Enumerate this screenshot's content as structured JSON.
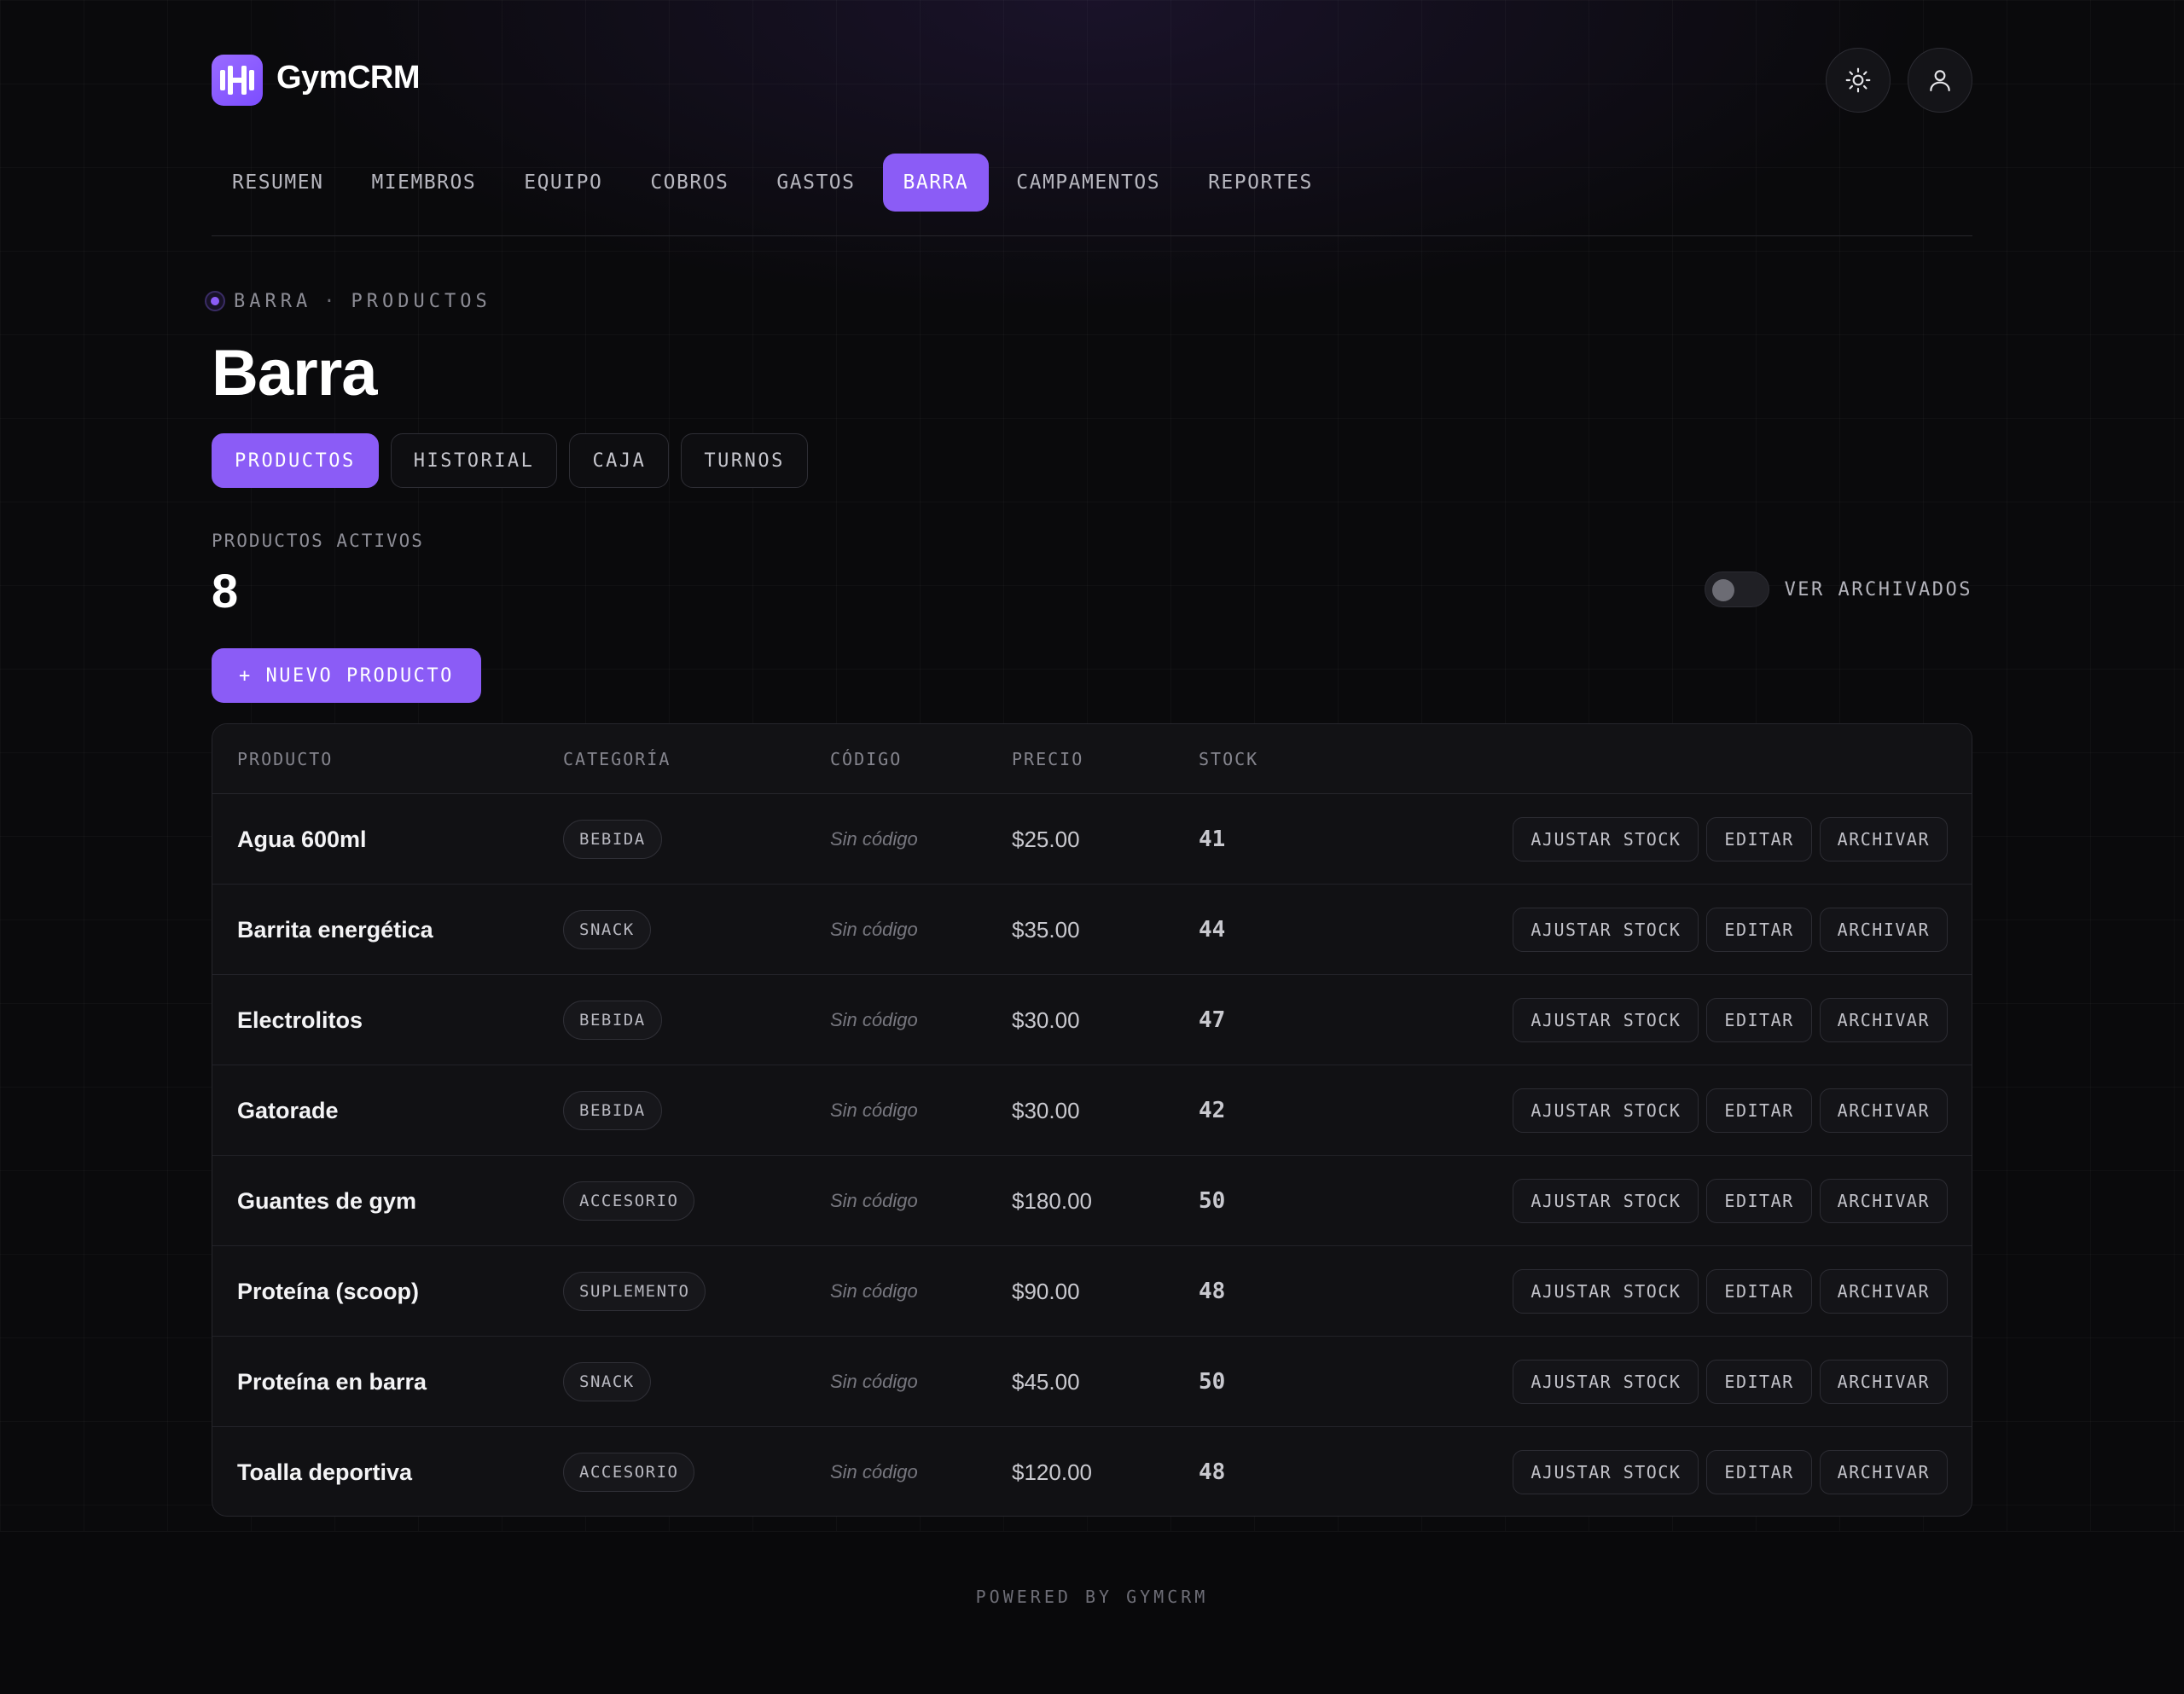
{
  "brand": {
    "name": "GymCRM"
  },
  "nav": {
    "items": [
      {
        "label": "RESUMEN",
        "active": false
      },
      {
        "label": "MIEMBROS",
        "active": false
      },
      {
        "label": "EQUIPO",
        "active": false
      },
      {
        "label": "COBROS",
        "active": false
      },
      {
        "label": "GASTOS",
        "active": false
      },
      {
        "label": "BARRA",
        "active": true
      },
      {
        "label": "CAMPAMENTOS",
        "active": false
      },
      {
        "label": "REPORTES",
        "active": false
      }
    ]
  },
  "header_icons": {
    "theme": "sun-icon",
    "profile": "user-icon"
  },
  "breadcrumb": {
    "section": "BARRA",
    "separator": "·",
    "page": "PRODUCTOS"
  },
  "page": {
    "title": "Barra"
  },
  "subtabs": [
    {
      "label": "PRODUCTOS",
      "active": true
    },
    {
      "label": "HISTORIAL",
      "active": false
    },
    {
      "label": "CAJA",
      "active": false
    },
    {
      "label": "TURNOS",
      "active": false
    }
  ],
  "stats": {
    "label": "PRODUCTOS ACTIVOS",
    "value": "8"
  },
  "archived_toggle": {
    "label": "VER ARCHIVADOS",
    "on": false
  },
  "new_product_button": {
    "label": "+ NUEVO PRODUCTO"
  },
  "table": {
    "columns": [
      "PRODUCTO",
      "CATEGORÍA",
      "CÓDIGO",
      "PRECIO",
      "STOCK"
    ],
    "actions": {
      "adjust": "AJUSTAR STOCK",
      "edit": "EDITAR",
      "archive": "ARCHIVAR"
    },
    "rows": [
      {
        "name": "Agua 600ml",
        "category": "BEBIDA",
        "code": "Sin código",
        "price": "$25.00",
        "stock": "41"
      },
      {
        "name": "Barrita energética",
        "category": "SNACK",
        "code": "Sin código",
        "price": "$35.00",
        "stock": "44"
      },
      {
        "name": "Electrolitos",
        "category": "BEBIDA",
        "code": "Sin código",
        "price": "$30.00",
        "stock": "47"
      },
      {
        "name": "Gatorade",
        "category": "BEBIDA",
        "code": "Sin código",
        "price": "$30.00",
        "stock": "42"
      },
      {
        "name": "Guantes de gym",
        "category": "ACCESORIO",
        "code": "Sin código",
        "price": "$180.00",
        "stock": "50"
      },
      {
        "name": "Proteína (scoop)",
        "category": "SUPLEMENTO",
        "code": "Sin código",
        "price": "$90.00",
        "stock": "48"
      },
      {
        "name": "Proteína en barra",
        "category": "SNACK",
        "code": "Sin código",
        "price": "$45.00",
        "stock": "50"
      },
      {
        "name": "Toalla deportiva",
        "category": "ACCESORIO",
        "code": "Sin código",
        "price": "$120.00",
        "stock": "48"
      }
    ]
  },
  "footer": {
    "text": "POWERED BY GYMCRM"
  },
  "colors": {
    "accent": "#8b5cf6",
    "background": "#0a0a0c",
    "surface": "#111114"
  }
}
